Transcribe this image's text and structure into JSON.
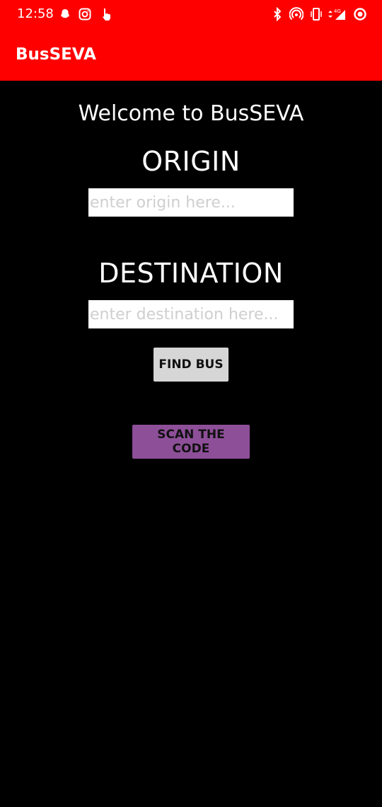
{
  "status_bar": {
    "time": "12:58",
    "left_icons": [
      "snapchat-icon",
      "instagram-icon",
      "touch-icon"
    ],
    "right_icons": [
      "bluetooth-icon",
      "hotspot-icon",
      "vibrate-icon",
      "data-arrows-icon",
      "signal-4g-icon",
      "record-icon"
    ]
  },
  "app_bar": {
    "title": "BusSEVA",
    "color": "#ff0000"
  },
  "main": {
    "welcome": "Welcome to BusSEVA",
    "origin_label": "ORIGIN",
    "origin_placeholder": "enter origin here...",
    "destination_label": "DESTINATION",
    "destination_placeholder": "enter destination here...",
    "find_button": "FIND BUS",
    "scan_button": "SCAN THE CODE",
    "scan_button_color": "#8e4f99"
  }
}
